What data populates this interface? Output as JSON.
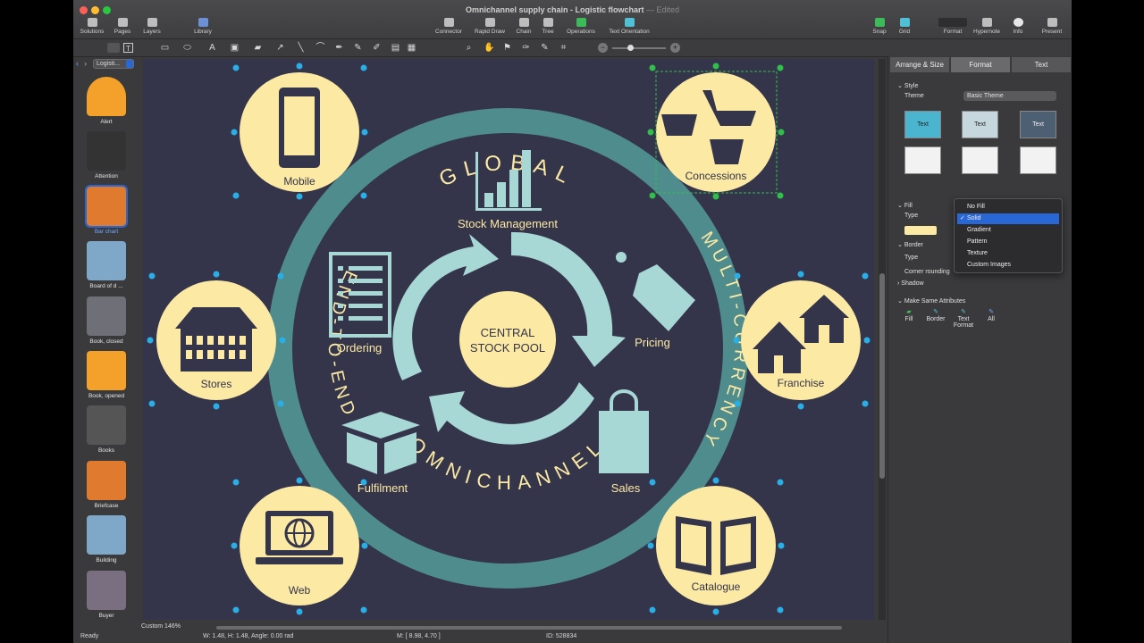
{
  "window": {
    "title": "Omnichannel supply chain - Logistic flowchart",
    "edited": "— Edited"
  },
  "toolbar": {
    "left": [
      "Solutions",
      "Pages",
      "Layers",
      "Library"
    ],
    "center": [
      "Connector",
      "Rapid Draw",
      "Chain",
      "Tree",
      "Operations",
      "Text Orientation"
    ],
    "right": [
      "Snap",
      "Grid",
      "Format",
      "Hypernote",
      "Info",
      "Present"
    ]
  },
  "library": {
    "selector": "Logisti...",
    "items": [
      "Alert",
      "Attention",
      "Bar chart",
      "Board of d ...",
      "Book, closed",
      "Book, opened",
      "Books",
      "Briefcase",
      "Building",
      "Buyer"
    ]
  },
  "diagram": {
    "ring_top": "GLOBAL",
    "ring_left": "END-TO-END",
    "ring_right": "MULTI-CURRENCY",
    "ring_bottom": "OMNICHANNEL",
    "center": "CENTRAL STOCK POOL",
    "center_line1": "CENTRAL",
    "center_line2": "STOCK POOL",
    "inner": {
      "stock": "Stock Management",
      "ordering": "Ordering",
      "pricing": "Pricing",
      "fulfilment": "Fulfilment",
      "sales": "Sales"
    },
    "nodes": {
      "mobile": "Mobile",
      "concessions": "Concessions",
      "stores": "Stores",
      "franchise": "Franchise",
      "web": "Web",
      "catalogue": "Catalogue"
    }
  },
  "panel": {
    "tabs": [
      "Arrange & Size",
      "Format",
      "Text"
    ],
    "style": "Style",
    "theme_label": "Theme",
    "theme_value": "Basic Theme",
    "swatch_text": "Text",
    "fill": "Fill",
    "type": "Type",
    "border": "Border",
    "corner": "Corner rounding",
    "shadow": "Shadow",
    "make_same": "Make Same Attributes",
    "make_same_items": [
      "Fill",
      "Border",
      "Text Format",
      "All"
    ],
    "fill_options": [
      "No Fill",
      "Solid",
      "Gradient",
      "Pattern",
      "Texture",
      "Custom Images"
    ],
    "fill_selected": "Solid"
  },
  "status": {
    "ready": "Ready",
    "geometry": "W: 1.48,  H: 1.48,  Angle: 0.00 rad",
    "mouse": "M: [ 8.98, 4.70 ]",
    "id": "ID: 528834",
    "zoom": "Custom 146%"
  },
  "colors": {
    "canvas_bg": "#34344a",
    "ring": "#4f8c8e",
    "node": "#fbe9a4",
    "icon_dark": "#34344a",
    "arrow": "#a8d8d6",
    "accent": "#2a67d6"
  }
}
